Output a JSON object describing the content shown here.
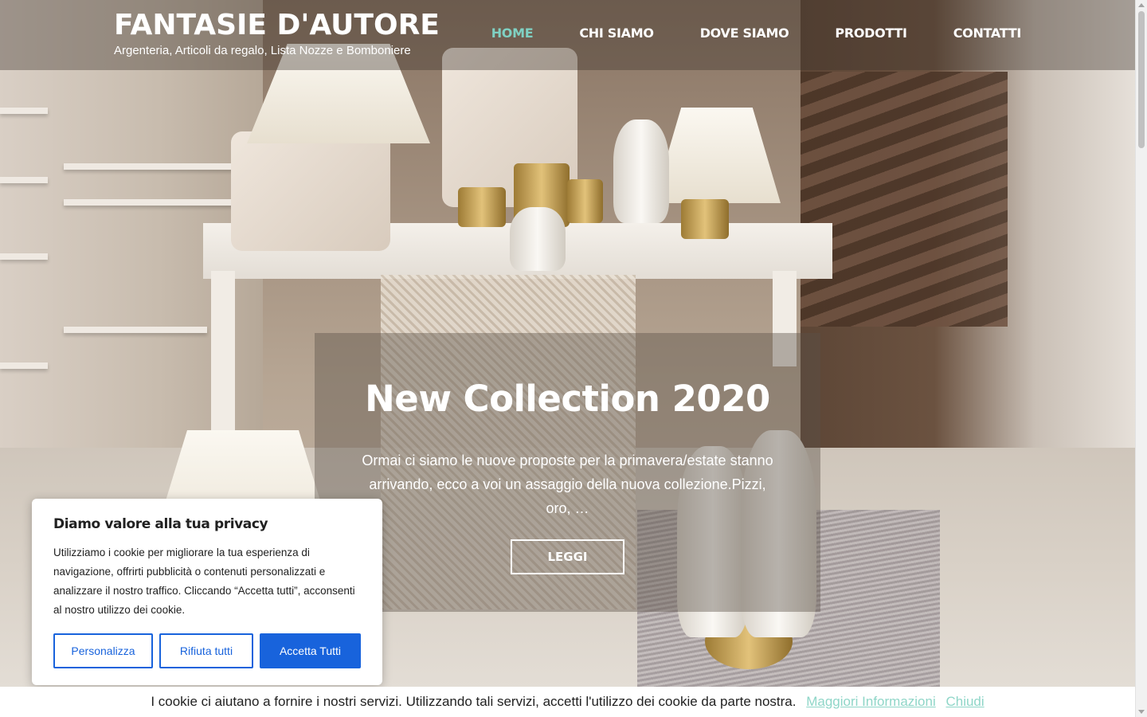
{
  "header": {
    "title": "FANTASIE D'AUTORE",
    "subtitle": "Argenteria, Articoli da regalo, Lista Nozze e Bomboniere"
  },
  "nav": {
    "items": [
      {
        "label": "HOME",
        "active": true
      },
      {
        "label": "CHI SIAMO",
        "active": false
      },
      {
        "label": "DOVE SIAMO",
        "active": false
      },
      {
        "label": "PRODOTTI",
        "active": false
      },
      {
        "label": "CONTATTI",
        "active": false
      }
    ]
  },
  "slide": {
    "title": "New Collection 2020",
    "text": "Ormai ci siamo le nuove proposte per la primavera/estate stanno arrivando, ecco a voi un assaggio della nuova collezione.Pizzi, oro, …",
    "button_label": "LEGGI"
  },
  "consent": {
    "title": "Diamo valore alla tua privacy",
    "text": "Utilizziamo i cookie per migliorare la tua esperienza di navigazione, offrirti pubblicità o contenuti personalizzati e analizzare il nostro traffico. Cliccando “Accetta tutti”, acconsenti al nostro utilizzo dei cookie.",
    "customize_label": "Personalizza",
    "reject_label": "Rifiuta tutti",
    "accept_label": "Accetta Tutti"
  },
  "cookie_bar": {
    "text": "I cookie ci aiutano a fornire i nostri servizi. Utilizzando tali servizi, accetti l'utilizzo dei cookie da parte nostra.",
    "more_info_label": "Maggiori Informazioni",
    "close_label": "Chiudi"
  },
  "colors": {
    "accent": "#7fd1c3",
    "consent_blue": "#1863dc",
    "cookie_link": "#8fd6c8"
  }
}
